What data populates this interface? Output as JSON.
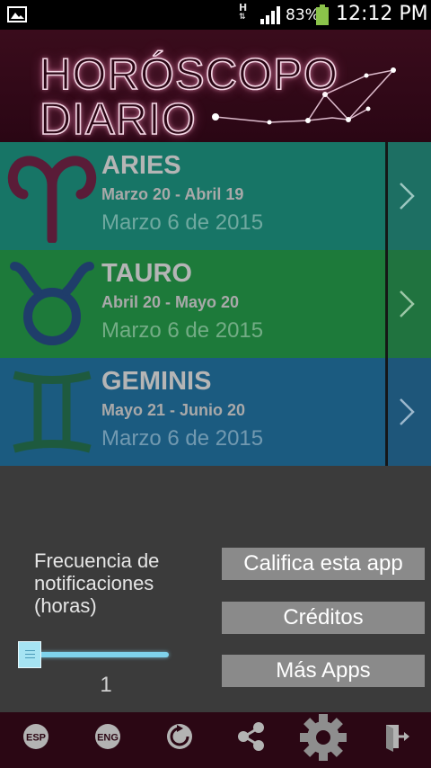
{
  "status_bar": {
    "net_top": "H",
    "net_bottom": "⇅",
    "battery": "83%",
    "time": "12:12 PM"
  },
  "header": {
    "title_line1": "HORÓSCOPO",
    "title_line2": "DIARIO"
  },
  "signs": [
    {
      "name": "ARIES",
      "range": "Marzo 20 - Abril 19",
      "date": "Marzo 6 de 2015",
      "icon": "aries-icon"
    },
    {
      "name": "TAURO",
      "range": "Abril 20 - Mayo 20",
      "date": "Marzo 6 de 2015",
      "icon": "taurus-icon"
    },
    {
      "name": "GEMINIS",
      "range": "Mayo 21 - Junio 20",
      "date": "Marzo 6 de 2015",
      "icon": "gemini-icon"
    }
  ],
  "settings": {
    "freq_label": "Frecuencia de notificaciones (horas)",
    "slider_value": "1",
    "slider_level": 0.0,
    "rate_label": "Califica esta app",
    "credits_label": "Créditos",
    "more_label": "Más Apps"
  },
  "toolbar": {
    "esp": "ESP",
    "eng": "ENG",
    "icons": [
      "language-esp-icon",
      "language-eng-icon",
      "refresh-icon",
      "share-icon",
      "settings-gear-icon",
      "exit-icon"
    ]
  },
  "colors": {
    "aries": "#177566",
    "tauro": "#1d7a3a",
    "geminis": "#1b5b80",
    "header": "#3a0c1c",
    "toolbar": "#2b0714",
    "button": "#8a8a8a",
    "slider": "#7fd3ec"
  }
}
